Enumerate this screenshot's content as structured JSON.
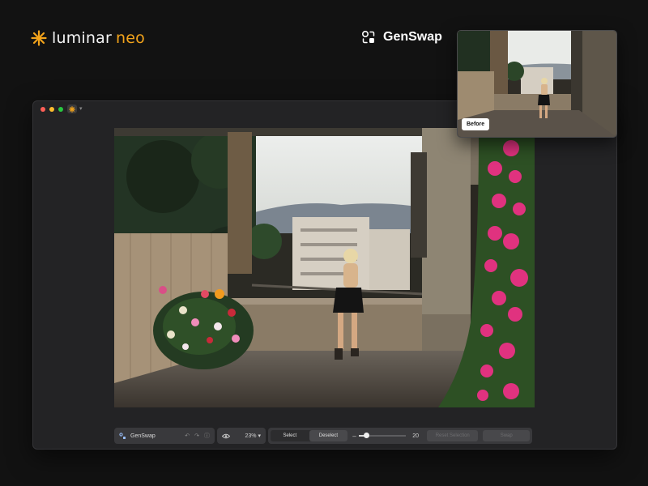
{
  "brand": {
    "name_part1": "luminar",
    "name_part2": "neo",
    "accent": "#f2a31b"
  },
  "feature": {
    "title": "GenSwap",
    "icon": "genswap-icon"
  },
  "window": {
    "traffic_lights": [
      "#ff5f57",
      "#febc2e",
      "#28c840"
    ]
  },
  "toolbar": {
    "tool_name": "GenSwap",
    "zoom": "23%",
    "select_label": "Select",
    "deselect_label": "Deselect",
    "brush_size": "20",
    "brush_fraction": 0.15,
    "remove_selection_label": "Reset Selection",
    "swap_label": "Swap"
  },
  "before_card": {
    "badge": "Before"
  }
}
